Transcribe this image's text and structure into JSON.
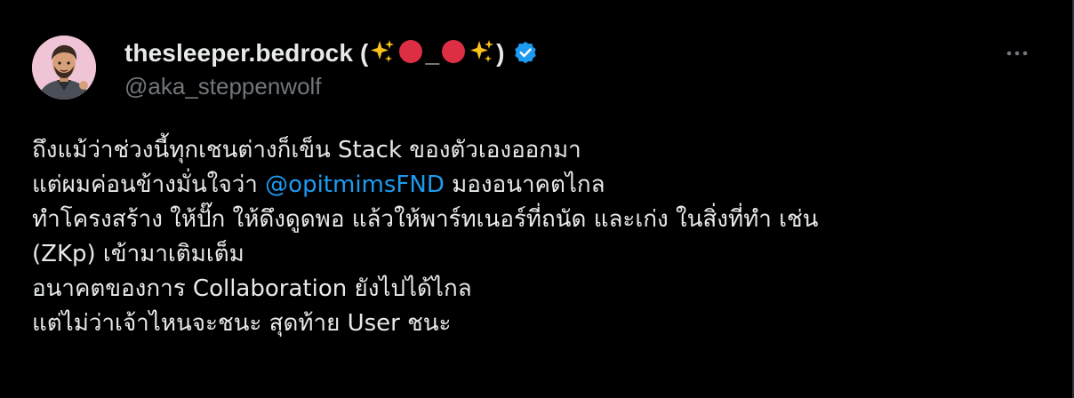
{
  "author": {
    "display_name": "thesleeper.bedrock",
    "name_open": "(",
    "name_underscore": "_",
    "name_close": ")",
    "handle": "@aka_steppenwolf",
    "verified_color": "#1d9bf0",
    "name_emojis": [
      "sparkles",
      "red-circle",
      "red-circle",
      "sparkles"
    ]
  },
  "actions": {
    "more_icon": "more-horizontal-icon"
  },
  "tweet": {
    "lines": [
      "ถึงแม้ว่าช่วงนี้ทุกเชนต่างก็เข็น Stack ของตัวเองออกมา",
      "",
      "ทำโครงสร้าง ให้ปั๊ก ให้ดึงดูดพอ แล้วให้พาร์ทเนอร์ที่ถนัด และเก่ง ในสิ่งที่ทำ เช่น",
      "(ZKp) เข้ามาเติมเต็ม",
      "อนาคตของการ Collaboration ยังไปได้ไกล",
      "แต่ไม่ว่าเจ้าไหนจะชนะ สุดท้าย User ชนะ"
    ],
    "line2_before": "แต่ผมค่อนข้างมั่นใจว่า ",
    "mention": "@opitmimsFND",
    "line2_after": " มองอนาคตไกล",
    "mention_color": "#1d9bf0"
  },
  "colors": {
    "background": "#000000",
    "text": "#e7e9ea",
    "secondary": "#71767b"
  }
}
